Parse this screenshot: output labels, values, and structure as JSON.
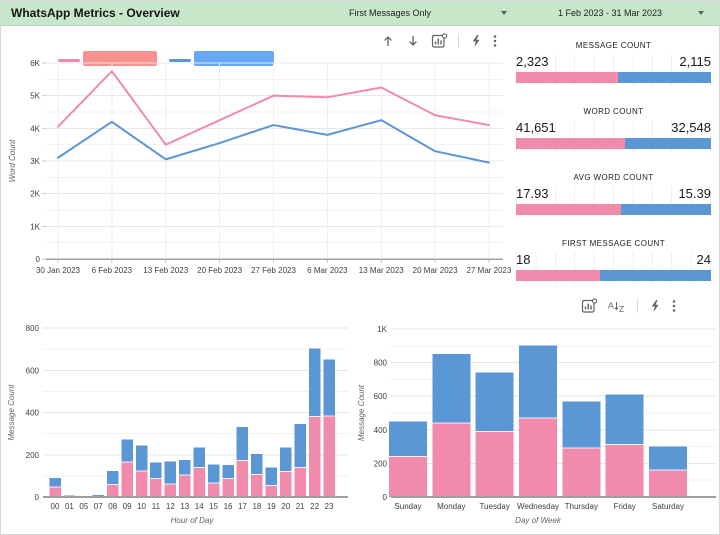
{
  "colors": {
    "header_green": "#C8E6C9",
    "series_pink": "#F18BAB",
    "series_blue": "#5B96D5",
    "redaction_pink": "#F9918F",
    "redaction_blue": "#66A9F2",
    "icon_gray": "#5f6368"
  },
  "header": {
    "title": "WhatsApp Metrics - Overview",
    "filter_label": "First Messages Only",
    "date_range": "1 Feb 2023 - 31 Mar 2023"
  },
  "toolbar_top": {
    "icons": [
      "arrow-up",
      "arrow-down",
      "explore-chart",
      "divider",
      "lightning-bolt",
      "more-vertical"
    ]
  },
  "toolbar_bottom": {
    "icons": [
      "explore-chart",
      "sort-az",
      "divider",
      "lightning-bolt",
      "more-vertical"
    ]
  },
  "legend": {
    "entries": [
      {
        "name": "",
        "name_redacted": true,
        "line_color": "#F18BAB",
        "redaction_color": "#F9918F"
      },
      {
        "name": "",
        "name_redacted": true,
        "line_color": "#5B96D5",
        "redaction_color": "#66A9F2"
      }
    ]
  },
  "scorecards": [
    {
      "label": "MESSAGE COUNT",
      "left": "2,323",
      "right": "2,115",
      "left_value": 2323,
      "right_value": 2115
    },
    {
      "label": "WORD COUNT",
      "left": "41,651",
      "right": "32,548",
      "left_value": 41651,
      "right_value": 32548
    },
    {
      "label": "AVG WORD COUNT",
      "left": "17.93",
      "right": "15.39",
      "left_value": 17.93,
      "right_value": 15.39
    },
    {
      "label": "FIRST MESSAGE COUNT",
      "left": "18",
      "right": "24",
      "left_value": 18,
      "right_value": 24
    }
  ],
  "chart_data": [
    {
      "type": "line",
      "ylabel": "Word Count",
      "ylim": [
        0,
        6000
      ],
      "yticks": [
        "0",
        "1K",
        "2K",
        "3K",
        "4K",
        "5K",
        "6K"
      ],
      "grid": "horizontal minor every 500, vertical at each date",
      "legend_position": "top",
      "x": [
        "30 Jan 2023",
        "6 Feb 2023",
        "13 Feb 2023",
        "20 Feb 2023",
        "27 Feb 2023",
        "6 Mar 2023",
        "13 Mar 2023",
        "20 Mar 2023",
        "27 Mar 2023"
      ],
      "series": [
        {
          "name": "",
          "name_redacted": true,
          "color": "#F18BAB",
          "values": [
            4050,
            5750,
            3500,
            4250,
            5000,
            4950,
            5250,
            4400,
            4100
          ]
        },
        {
          "name": "",
          "name_redacted": true,
          "color": "#5B96D5",
          "values": [
            3100,
            4200,
            3050,
            3550,
            4100,
            3800,
            4250,
            3300,
            2950
          ]
        }
      ]
    },
    {
      "type": "bar",
      "stacked": true,
      "xlabel": "Hour of Day",
      "ylabel": "Message Count",
      "ylim": [
        0,
        800
      ],
      "yticks": [
        "0",
        "200",
        "400",
        "600",
        "800"
      ],
      "categories": [
        "00",
        "01",
        "05",
        "07",
        "08",
        "09",
        "10",
        "11",
        "12",
        "13",
        "14",
        "15",
        "16",
        "17",
        "18",
        "19",
        "20",
        "21",
        "22",
        "23"
      ],
      "series": [
        {
          "name": "",
          "name_redacted": true,
          "color": "#F18BAB",
          "values": [
            48,
            3,
            2,
            3,
            60,
            165,
            123,
            87,
            62,
            104,
            140,
            67,
            87,
            173,
            106,
            54,
            121,
            139,
            381,
            383
          ]
        },
        {
          "name": "",
          "name_redacted": true,
          "color": "#5B96D5",
          "values": [
            41,
            5,
            2,
            6,
            63,
            107,
            120,
            77,
            106,
            72,
            95,
            87,
            65,
            158,
            98,
            85,
            114,
            207,
            322,
            268
          ]
        }
      ]
    },
    {
      "type": "bar",
      "stacked": true,
      "xlabel": "Day of Week",
      "ylabel": "Message Count",
      "ylim": [
        0,
        1000
      ],
      "yticks": [
        "0",
        "200",
        "400",
        "600",
        "800",
        "1K"
      ],
      "categories": [
        "Sunday",
        "Monday",
        "Tuesday",
        "Wednesday",
        "Thursday",
        "Friday",
        "Saturday"
      ],
      "series": [
        {
          "name": "",
          "name_redacted": true,
          "color": "#F18BAB",
          "values": [
            240,
            440,
            390,
            470,
            292,
            312,
            162
          ]
        },
        {
          "name": "",
          "name_redacted": true,
          "color": "#5B96D5",
          "values": [
            210,
            410,
            350,
            433,
            276,
            298,
            140
          ]
        }
      ]
    }
  ]
}
